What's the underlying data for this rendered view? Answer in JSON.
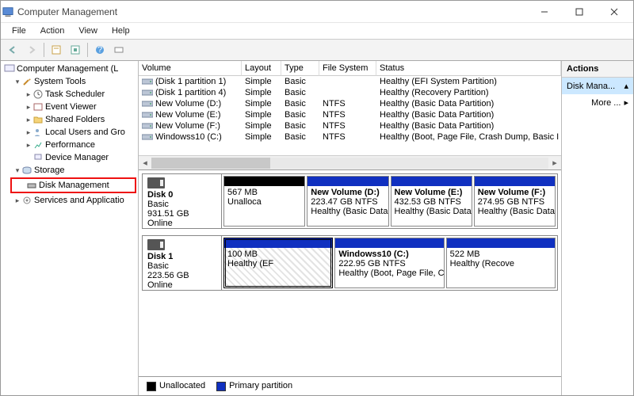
{
  "window": {
    "title": "Computer Management"
  },
  "menu": {
    "file": "File",
    "action": "Action",
    "view": "View",
    "help": "Help"
  },
  "tree": {
    "root": "Computer Management (L",
    "system_tools": "System Tools",
    "task_scheduler": "Task Scheduler",
    "event_viewer": "Event Viewer",
    "shared_folders": "Shared Folders",
    "local_users": "Local Users and Gro",
    "performance": "Performance",
    "device_manager": "Device Manager",
    "storage": "Storage",
    "disk_management": "Disk Management",
    "services": "Services and Applicatio"
  },
  "columns": {
    "volume": "Volume",
    "layout": "Layout",
    "type": "Type",
    "fs": "File System",
    "status": "Status"
  },
  "volumes": [
    {
      "name": "(Disk 1 partition 1)",
      "layout": "Simple",
      "type": "Basic",
      "fs": "",
      "status": "Healthy (EFI System Partition)"
    },
    {
      "name": "(Disk 1 partition 4)",
      "layout": "Simple",
      "type": "Basic",
      "fs": "",
      "status": "Healthy (Recovery Partition)"
    },
    {
      "name": "New Volume (D:)",
      "layout": "Simple",
      "type": "Basic",
      "fs": "NTFS",
      "status": "Healthy (Basic Data Partition)"
    },
    {
      "name": "New Volume (E:)",
      "layout": "Simple",
      "type": "Basic",
      "fs": "NTFS",
      "status": "Healthy (Basic Data Partition)"
    },
    {
      "name": "New Volume (F:)",
      "layout": "Simple",
      "type": "Basic",
      "fs": "NTFS",
      "status": "Healthy (Basic Data Partition)"
    },
    {
      "name": "Windowss10 (C:)",
      "layout": "Simple",
      "type": "Basic",
      "fs": "NTFS",
      "status": "Healthy (Boot, Page File, Crash Dump, Basic I"
    }
  ],
  "disks": [
    {
      "title": "Disk 0",
      "kind": "Basic",
      "size": "931.51 GB",
      "state": "Online",
      "parts": [
        {
          "bar": "black",
          "name": "",
          "l2": "567 MB",
          "l3": "Unalloca"
        },
        {
          "bar": "blue",
          "name": "New Volume  (D:)",
          "l2": "223.47 GB NTFS",
          "l3": "Healthy (Basic Data"
        },
        {
          "bar": "blue",
          "name": "New Volume  (E:)",
          "l2": "432.53 GB NTFS",
          "l3": "Healthy (Basic Data"
        },
        {
          "bar": "blue",
          "name": "New Volume  (F:)",
          "l2": "274.95 GB NTFS",
          "l3": "Healthy (Basic Data"
        }
      ]
    },
    {
      "title": "Disk 1",
      "kind": "Basic",
      "size": "223.56 GB",
      "state": "Online",
      "parts": [
        {
          "bar": "blue",
          "hatch": true,
          "sel": true,
          "name": "",
          "l2": "100 MB",
          "l3": "Healthy (EF"
        },
        {
          "bar": "blue",
          "name": "Windowss10  (C:)",
          "l2": "222.95 GB NTFS",
          "l3": "Healthy (Boot, Page File, Crash Du"
        },
        {
          "bar": "blue",
          "name": "",
          "l2": "522 MB",
          "l3": "Healthy (Recove"
        }
      ]
    }
  ],
  "legend": {
    "unallocated": "Unallocated",
    "primary": "Primary partition"
  },
  "actions": {
    "header": "Actions",
    "selected": "Disk Mana...",
    "more": "More ..."
  }
}
